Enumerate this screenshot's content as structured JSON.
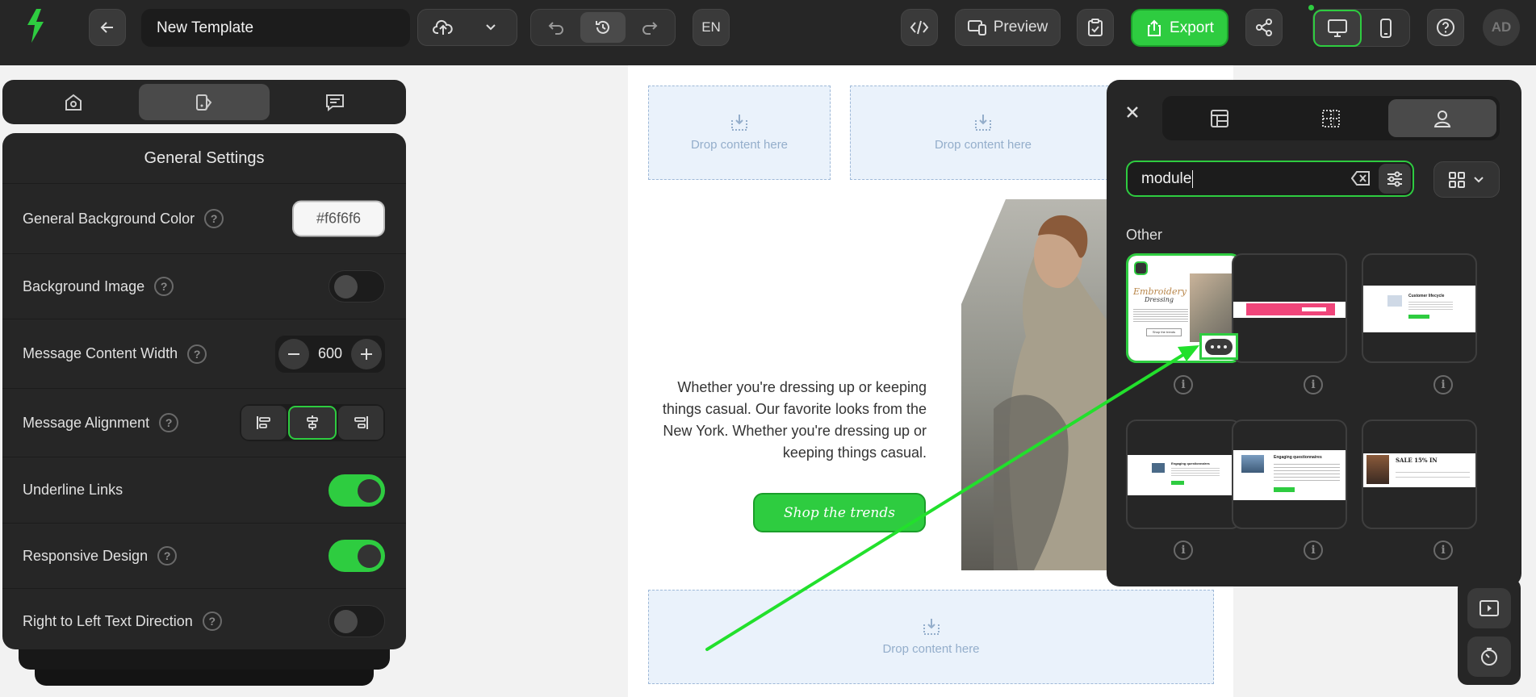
{
  "toolbar": {
    "template_name": "New Template",
    "language": "EN",
    "preview_label": "Preview",
    "export_label": "Export",
    "avatar_initials": "AD",
    "accent_color": "#2ecc40"
  },
  "left_panel": {
    "tabs": [
      "general-settings",
      "style",
      "comments"
    ],
    "active_tab": "style",
    "settings": {
      "title": "General Settings",
      "background_color_label": "General Background Color",
      "background_color_value": "#f6f6f6",
      "background_image_label": "Background Image",
      "background_image_enabled": false,
      "content_width_label": "Message Content Width",
      "content_width_value": "600",
      "alignment_label": "Message Alignment",
      "alignment_value": "center",
      "underline_links_label": "Underline Links",
      "underline_links_enabled": true,
      "responsive_label": "Responsive Design",
      "responsive_enabled": true,
      "rtl_label": "Right to Left Text Direction",
      "rtl_enabled": false,
      "help_glyph": "?"
    }
  },
  "canvas": {
    "drop_label": "Drop content here",
    "hero_text": "Whether you're dressing up or keeping things casual. Our favorite looks from the New York. Whether you're dressing up or keeping things casual.",
    "cta_label": "Shop the trends"
  },
  "modules_panel": {
    "search_value": "module",
    "section_title": "Other",
    "info_glyph": "i",
    "thumb_texts": {
      "embroidery_title": "Embroidery",
      "embroidery_sub": "Dressing",
      "shop_small": "Shop the trends",
      "customer_lifecycle": "Customer lifecycle",
      "engaging_questionnaires": "Engaging questionnaires",
      "sale": "SALE 15% IN"
    }
  }
}
